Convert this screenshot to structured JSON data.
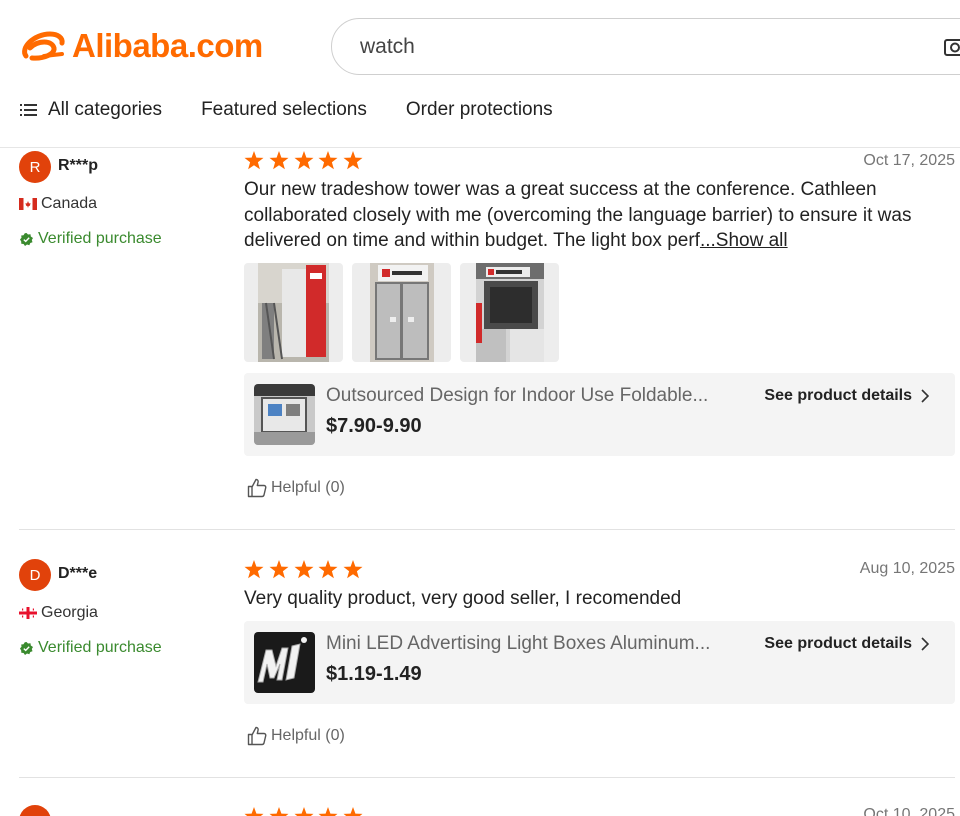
{
  "header": {
    "logo_text": "Alibaba.com",
    "brand_color": "#ff6a00",
    "search_value": "watch",
    "search_icon": "camera-icon",
    "nav": [
      {
        "label": "All categories",
        "icon": "menu-icon"
      },
      {
        "label": "Featured selections"
      },
      {
        "label": "Order protections"
      }
    ]
  },
  "reviews": [
    {
      "avatar_letter": "R",
      "username": "R***p",
      "country": "Canada",
      "verified_label": "Verified purchase",
      "rating": 5,
      "date": "Oct 17, 2025",
      "text": "Our new tradeshow tower was a great success at the conference. Cathleen collaborated closely with me (overcoming the language barrier) to ensure it was delivered on time and within budget. The light box perf",
      "show_all_label": "...Show all",
      "product_name": "Outsourced Design for Indoor Use Foldable...",
      "product_price": "$7.90-9.90",
      "see_details_label": "See product details",
      "helpful_label": "Helpful (0)"
    },
    {
      "avatar_letter": "D",
      "username": "D***e",
      "country": "Georgia",
      "verified_label": "Verified purchase",
      "rating": 5,
      "date": "Aug 10, 2025",
      "text": "Very quality product, very good seller, I recomended",
      "product_name": "Mini LED Advertising Light Boxes Aluminum...",
      "product_price": "$1.19-1.49",
      "see_details_label": "See product details",
      "helpful_label": "Helpful (0)"
    },
    {
      "date": "Oct 10, 2025"
    }
  ],
  "colors": {
    "star": "#ff6a00",
    "avatar": "#e1420b",
    "verified": "#3a8a2e"
  }
}
